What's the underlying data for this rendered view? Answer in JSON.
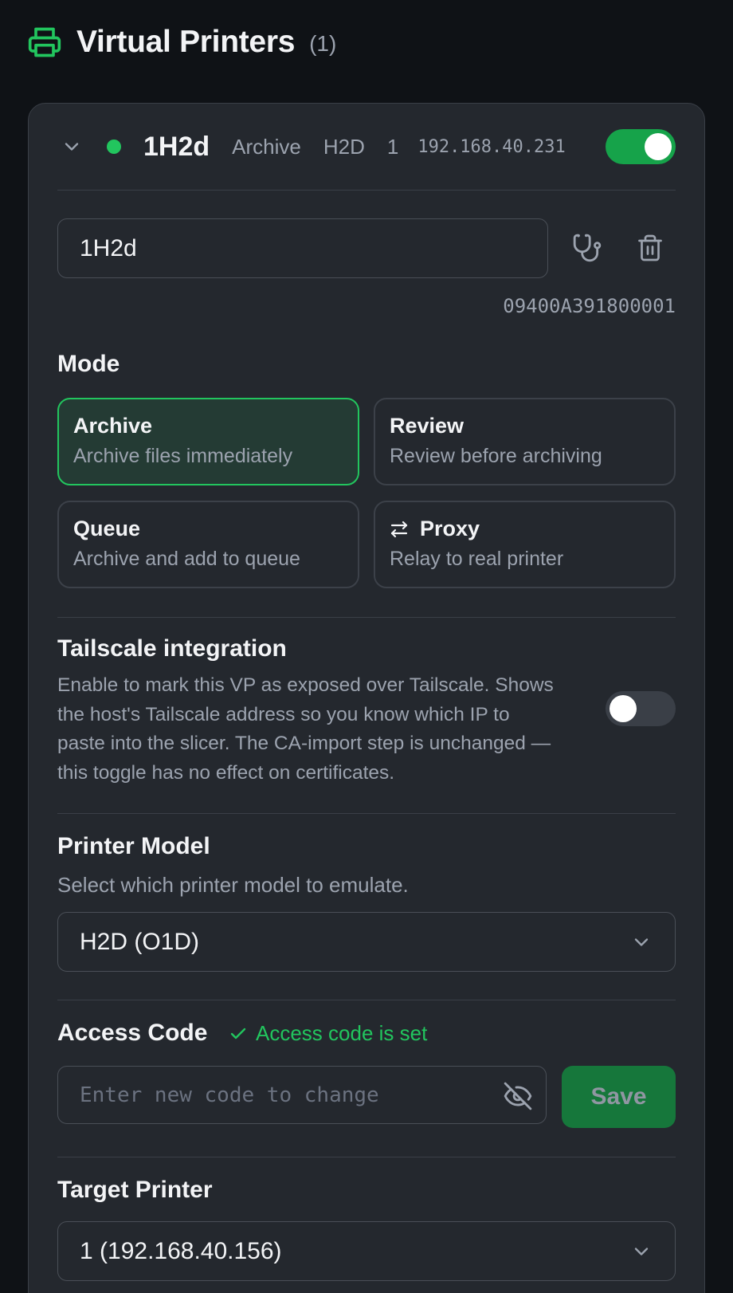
{
  "colors": {
    "accent": "#22c55e",
    "background": "#0f1216",
    "card": "#24282e",
    "muted": "#9ca3af"
  },
  "header": {
    "title": "Virtual Printers",
    "count": "(1)",
    "icon": "printer-icon"
  },
  "printer": {
    "expanded": true,
    "status": "online",
    "name": "1H2d",
    "mode": "Archive",
    "model": "H2D",
    "printer_number": "1",
    "ip": "192.168.40.231",
    "enabled": true,
    "name_value": "1H2d",
    "serial": "09400A391800001",
    "actions": {
      "diagnose_icon": "stethoscope-icon",
      "delete_icon": "trash-icon"
    }
  },
  "mode_section": {
    "title": "Mode",
    "selected": "archive",
    "options": [
      {
        "id": "archive",
        "title": "Archive",
        "desc": "Archive files immediately"
      },
      {
        "id": "review",
        "title": "Review",
        "desc": "Review before archiving"
      },
      {
        "id": "queue",
        "title": "Queue",
        "desc": "Archive and add to queue"
      },
      {
        "id": "proxy",
        "title": "Proxy",
        "desc": "Relay to real printer",
        "icon": "swap-arrows-icon"
      }
    ]
  },
  "tailscale": {
    "title": "Tailscale integration",
    "line1": "Enable to mark this VP as exposed over Tailscale. Shows",
    "line2": "the host's Tailscale address so you know which IP to",
    "line3": "paste into the slicer. The CA-import step is unchanged —",
    "line4": "this toggle has no effect on certificates.",
    "enabled": false
  },
  "printer_model": {
    "title": "Printer Model",
    "description": "Select which printer model to emulate.",
    "selected": "H2D (O1D)"
  },
  "access_code": {
    "title": "Access Code",
    "status": "Access code is set",
    "placeholder": "Enter new code to change",
    "value": "",
    "save_label": "Save"
  },
  "target_printer": {
    "title": "Target Printer",
    "selected": "1 (192.168.40.156)"
  }
}
